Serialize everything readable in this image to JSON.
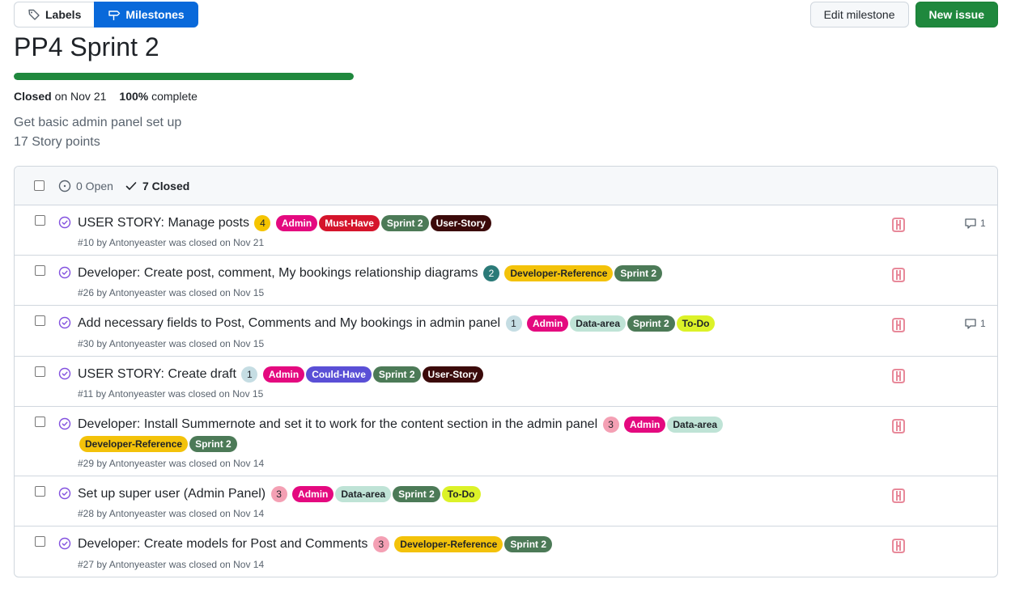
{
  "nav": {
    "labels": "Labels",
    "milestones": "Milestones"
  },
  "actions": {
    "edit": "Edit milestone",
    "new_issue": "New issue"
  },
  "milestone": {
    "title": "PP4 Sprint 2",
    "progress_percent": 100,
    "closed_word": "Closed",
    "closed_date": " on Nov 21",
    "percent_text": "100%",
    "complete_word": " complete",
    "description_line1": "Get basic admin panel set up",
    "description_line2": "17 Story points"
  },
  "filters": {
    "open": "0 Open",
    "closed": "7 Closed"
  },
  "colors": {
    "accent": "#0969da",
    "success": "#1f883d",
    "closed_purple": "#8250df",
    "avatar": "#e8899a"
  },
  "labels": {
    "Admin": {
      "bg": "#e4097f",
      "fg": "#ffffff"
    },
    "Must-Have": {
      "bg": "#d5142b",
      "fg": "#ffffff"
    },
    "Sprint 2": {
      "bg": "#4c7a57",
      "fg": "#ffffff"
    },
    "User-Story": {
      "bg": "#3b0a0a",
      "fg": "#ffffff"
    },
    "Developer-Reference": {
      "bg": "#f3c20a",
      "fg": "#1f2328"
    },
    "Data-area": {
      "bg": "#bfe3d6",
      "fg": "#1f2328"
    },
    "To-Do": {
      "bg": "#dcf228",
      "fg": "#1f2328"
    },
    "Could-Have": {
      "bg": "#5a4fd6",
      "fg": "#ffffff"
    }
  },
  "issues": [
    {
      "title": "USER STORY: Manage posts",
      "points": "4",
      "points_bg": "#f5c400",
      "points_fg": "#1f2328",
      "labels": [
        "Admin",
        "Must-Have",
        "Sprint 2",
        "User-Story"
      ],
      "meta": "#10 by Antonyeaster was closed on Nov 21",
      "comments": "1"
    },
    {
      "title": "Developer: Create post, comment, My bookings relationship diagrams",
      "points": "2",
      "points_bg": "#2b7a78",
      "points_fg": "#ffffff",
      "labels": [
        "Developer-Reference",
        "Sprint 2"
      ],
      "meta": "#26 by Antonyeaster was closed on Nov 15",
      "comments": ""
    },
    {
      "title": "Add necessary fields to Post, Comments and My bookings in admin panel",
      "points": "1",
      "points_bg": "#c5dde3",
      "points_fg": "#1f2328",
      "labels": [
        "Admin",
        "Data-area",
        "Sprint 2",
        "To-Do"
      ],
      "meta": "#30 by Antonyeaster was closed on Nov 15",
      "comments": "1"
    },
    {
      "title": "USER STORY: Create draft",
      "points": "1",
      "points_bg": "#c5dde3",
      "points_fg": "#1f2328",
      "labels": [
        "Admin",
        "Could-Have",
        "Sprint 2",
        "User-Story"
      ],
      "meta": "#11 by Antonyeaster was closed on Nov 15",
      "comments": ""
    },
    {
      "title": "Developer: Install Summernote and set it to work for the content section in the admin panel",
      "points": "3",
      "points_bg": "#f4a0b4",
      "points_fg": "#1f2328",
      "labels": [
        "Admin",
        "Data-area",
        "Developer-Reference",
        "Sprint 2"
      ],
      "meta": "#29 by Antonyeaster was closed on Nov 14",
      "comments": ""
    },
    {
      "title": "Set up super user (Admin Panel)",
      "points": "3",
      "points_bg": "#f4a0b4",
      "points_fg": "#1f2328",
      "labels": [
        "Admin",
        "Data-area",
        "Sprint 2",
        "To-Do"
      ],
      "meta": "#28 by Antonyeaster was closed on Nov 14",
      "comments": ""
    },
    {
      "title": "Developer: Create models for Post and Comments",
      "points": "3",
      "points_bg": "#f4a0b4",
      "points_fg": "#1f2328",
      "labels": [
        "Developer-Reference",
        "Sprint 2"
      ],
      "meta": "#27 by Antonyeaster was closed on Nov 14",
      "comments": ""
    }
  ]
}
